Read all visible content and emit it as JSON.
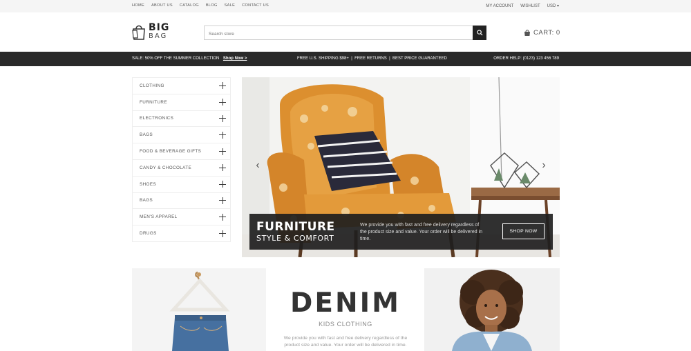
{
  "topbar": {
    "nav": [
      "HOME",
      "ABOUT US",
      "CATALOG",
      "BLOG",
      "SALE",
      "CONTACT US"
    ],
    "my_account": "MY ACCOUNT",
    "wishlist": "WISHLIST",
    "currency": "USD"
  },
  "header": {
    "logo_big": "BIG",
    "logo_small": "BAG",
    "search_placeholder": "Search store",
    "cart_label": "CART: 0"
  },
  "promo": {
    "sale_text": "SALE: 50% OFF THE SUMMER COLLECTION",
    "shop_link": "Shop Now >",
    "shipping_text": "FREE U.S. SHIPPING $98+  |  FREE RETURNS  |  BEST PRICE GUARANTEED",
    "order_help": "ORDER HELP: (0123) 123 456 789"
  },
  "categories": [
    "CLOTHING",
    "FURNITURE",
    "ELECTRONICS",
    "BAGS",
    "FOOD & BEVERAGE GIFTS",
    "CANDY & CHOCOLATE",
    "SHOES",
    "BAGS",
    "MEN'S APPAREL",
    "DRUGS"
  ],
  "hero": {
    "title": "FURNITURE",
    "subtitle": "STYLE & COMFORT",
    "description": "We provide you with fast and free delivery regardless of the product size and value. Your order will be delivered in time.",
    "button": "SHOP NOW"
  },
  "denim": {
    "title": "DENIM",
    "subtitle": "KIDS CLOTHING",
    "description": "We provide you with fast and free delivery regardless of the product size and value. Your order will be delivered in time."
  },
  "colors": {
    "promo_bar": "#2a2a2a",
    "chair_orange": "#d88a2a",
    "accent_dark": "#222222"
  }
}
